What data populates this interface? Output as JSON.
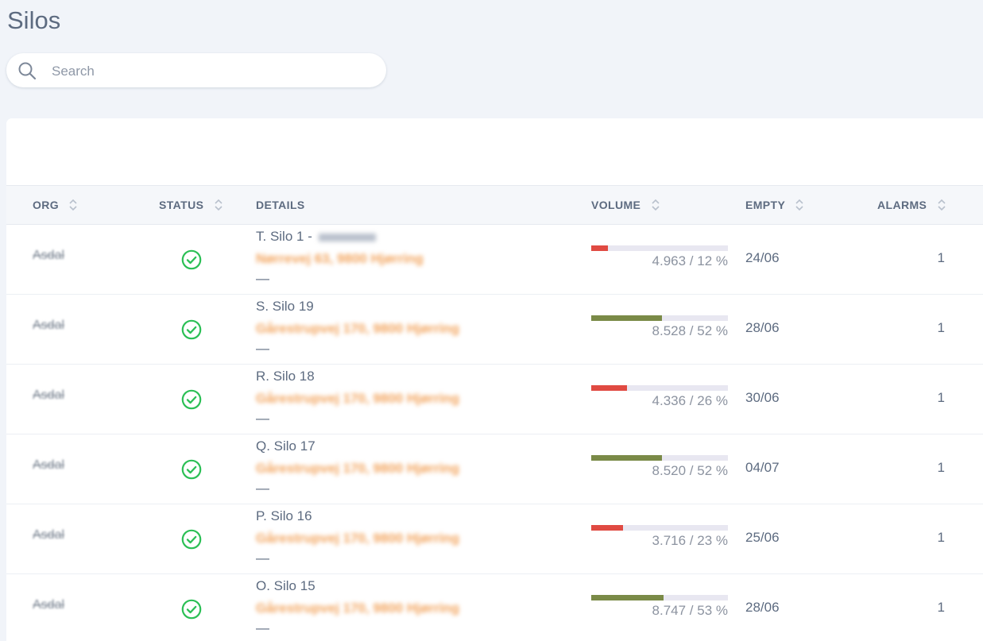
{
  "page": {
    "title": "Silos"
  },
  "search": {
    "placeholder": "Search",
    "value": ""
  },
  "colors": {
    "status_ok": "#2bbf55",
    "volume_low": "#e04a42",
    "volume_ok": "#7a8a47",
    "address": "#f2a25a"
  },
  "table": {
    "columns": [
      {
        "key": "org",
        "label": "ORG",
        "sortable": true
      },
      {
        "key": "status",
        "label": "STATUS",
        "sortable": true
      },
      {
        "key": "details",
        "label": "DETAILS",
        "sortable": false
      },
      {
        "key": "volume",
        "label": "VOLUME",
        "sortable": true
      },
      {
        "key": "empty",
        "label": "EMPTY",
        "sortable": true
      },
      {
        "key": "alarms",
        "label": "ALARMS",
        "sortable": true
      }
    ],
    "rows": [
      {
        "org": "Asdal",
        "status": "ok",
        "status_icon": "check-circle-icon",
        "name": "T. Silo 1 - ",
        "name_redacted": true,
        "address": "Nørrevej 63, 9800 Hjørring",
        "extra": "—",
        "volume_text": "4.963 / 12 %",
        "volume_pct": 12,
        "volume_color": "#e04a42",
        "empty": "24/06",
        "alarms": "1"
      },
      {
        "org": "Asdal",
        "status": "ok",
        "status_icon": "check-circle-icon",
        "name": "S. Silo 19",
        "name_redacted": false,
        "address": "Gårestrupvej 170, 9800 Hjørring",
        "extra": "—",
        "volume_text": "8.528 / 52 %",
        "volume_pct": 52,
        "volume_color": "#7a8a47",
        "empty": "28/06",
        "alarms": "1"
      },
      {
        "org": "Asdal",
        "status": "ok",
        "status_icon": "check-circle-icon",
        "name": "R. Silo 18",
        "name_redacted": false,
        "address": "Gårestrupvej 170, 9800 Hjørring",
        "extra": "—",
        "volume_text": "4.336 / 26 %",
        "volume_pct": 26,
        "volume_color": "#e04a42",
        "empty": "30/06",
        "alarms": "1"
      },
      {
        "org": "Asdal",
        "status": "ok",
        "status_icon": "check-circle-icon",
        "name": "Q. Silo 17",
        "name_redacted": false,
        "address": "Gårestrupvej 170, 9800 Hjørring",
        "extra": "—",
        "volume_text": "8.520 / 52 %",
        "volume_pct": 52,
        "volume_color": "#7a8a47",
        "empty": "04/07",
        "alarms": "1"
      },
      {
        "org": "Asdal",
        "status": "ok",
        "status_icon": "check-circle-icon",
        "name": "P. Silo 16",
        "name_redacted": false,
        "address": "Gårestrupvej 170, 9800 Hjørring",
        "extra": "—",
        "volume_text": "3.716 / 23 %",
        "volume_pct": 23,
        "volume_color": "#e04a42",
        "empty": "25/06",
        "alarms": "1"
      },
      {
        "org": "Asdal",
        "status": "ok",
        "status_icon": "check-circle-icon",
        "name": "O. Silo 15",
        "name_redacted": false,
        "address": "Gårestrupvej 170, 9800 Hjørring",
        "extra": "—",
        "volume_text": "8.747 / 53 %",
        "volume_pct": 53,
        "volume_color": "#7a8a47",
        "empty": "28/06",
        "alarms": "1"
      }
    ]
  }
}
